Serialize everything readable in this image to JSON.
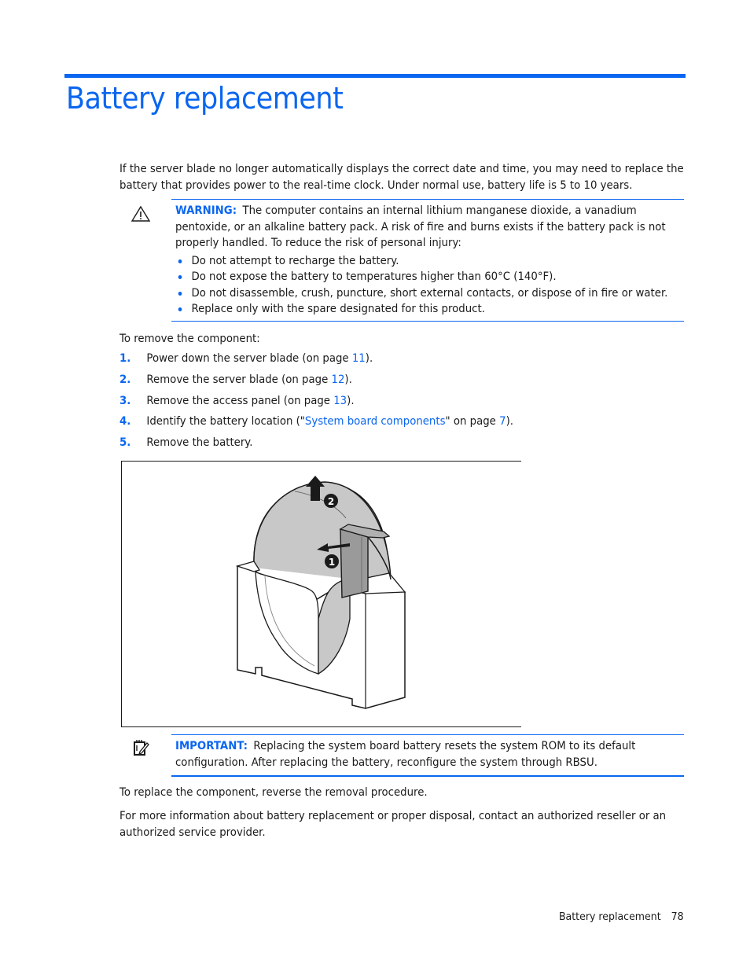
{
  "page": {
    "title": "Battery replacement",
    "intro": [
      "If the server blade no longer automatically displays the correct date and time, you may need to replace the",
      "battery that provides power to the real-time clock. Under normal use, battery life is 5 to 10 years."
    ]
  },
  "warning": {
    "icon": "warning-triangle-icon",
    "label": "WARNING:",
    "lines": [
      "The computer contains an internal lithium manganese dioxide, a vanadium",
      "pentoxide, or an alkaline battery pack. A risk of fire and burns exists if the battery pack is not",
      "properly handled. To reduce the risk of personal injury:"
    ],
    "bullets": [
      "Do not attempt to recharge the battery.",
      "Do not expose the battery to temperatures higher than 60°C (140°F).",
      "Do not disassemble, crush, puncture, short external contacts, or dispose of in fire or water.",
      "Replace only with the spare designated for this product."
    ]
  },
  "removal": {
    "intro": "To remove the component:",
    "steps": [
      {
        "num": "1.",
        "before": "Power down the server blade (on page ",
        "link": "11",
        "after": ")."
      },
      {
        "num": "2.",
        "before": "Remove the server blade (on page ",
        "link": "12",
        "after": ")."
      },
      {
        "num": "3.",
        "before": "Remove the access panel (on page ",
        "link": "13",
        "after": ")."
      },
      {
        "num": "4.",
        "before": "Identify the battery location (\"",
        "link": "System board components",
        "middle": "\" on page ",
        "link2": "7",
        "after": ")."
      },
      {
        "num": "5.",
        "before": "Remove the battery.",
        "link": "",
        "after": ""
      }
    ]
  },
  "figure": {
    "callouts": [
      "1",
      "2"
    ]
  },
  "important": {
    "icon": "important-notepad-icon",
    "label": "IMPORTANT:",
    "lines": [
      "Replacing the system board battery resets the system ROM to its default",
      "configuration. After replacing the battery, reconfigure the system through RBSU."
    ]
  },
  "closing": {
    "reverse": "To replace the component, reverse the removal procedure.",
    "more_info": [
      "For more information about battery replacement or proper disposal, contact an authorized reseller or an",
      "authorized service provider."
    ]
  },
  "footer": {
    "section": "Battery replacement",
    "page_number": "78"
  },
  "colors": {
    "accent": "#0a66f0",
    "text": "#1a1a1a"
  }
}
